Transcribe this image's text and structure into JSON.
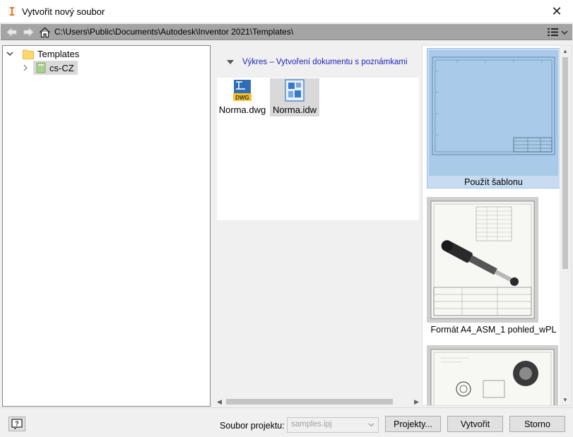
{
  "window": {
    "title": "Vytvořit nový soubor",
    "close_glyph": "✕"
  },
  "addressbar": {
    "path": "C:\\Users\\Public\\Documents\\Autodesk\\Inventor 2021\\Templates\\"
  },
  "tree": {
    "root": {
      "label": "Templates",
      "icon": "folder-icon",
      "expanded": true
    },
    "child": {
      "label": "cs-CZ",
      "icon": "template-folder-icon",
      "expanded": false,
      "selected": true
    }
  },
  "group": {
    "title": "Výkres – Vytvoření dokumentu s poznámkami"
  },
  "files": [
    {
      "label": "Norma.dwg",
      "icon": "dwg-file-icon",
      "badge": "DWG",
      "selected": false
    },
    {
      "label": "Norma.idw",
      "icon": "idw-file-icon",
      "selected": true
    }
  ],
  "previews": [
    {
      "caption": "Použít šablonu",
      "selected": true
    },
    {
      "caption": "Formát A4_ASM_1 pohled_wPL",
      "selected": false
    },
    {
      "caption": "",
      "selected": false
    }
  ],
  "bottom": {
    "help_glyph": "?",
    "project_label": "Soubor projektu:",
    "project_value": "samples.ipj",
    "projects_button": "Projekty...",
    "create_button": "Vytvořit",
    "cancel_button": "Storno"
  },
  "colors": {
    "accent_blue": "#1d1dbd",
    "selection_blue": "#c7dcf0",
    "address_bar": "#a4a4a4"
  }
}
